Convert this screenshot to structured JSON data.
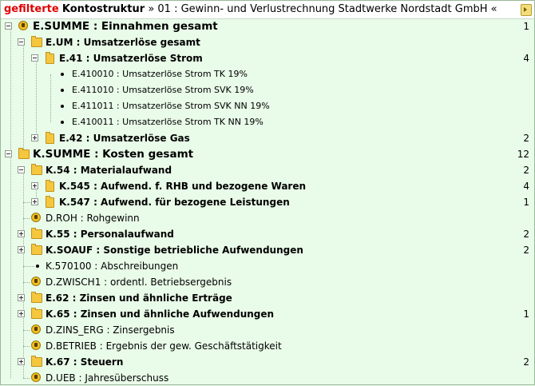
{
  "header": {
    "filter_label": "gefilterte",
    "title": "Kontostruktur",
    "path": "» 01 : Gewinn- und Verlustrechnung Stadtwerke Nordstadt GmbH «"
  },
  "rows": [
    {
      "label": "E.SUMME : Einnahmen gesamt",
      "count": "1"
    },
    {
      "label": "E.UM : Umsatzerlöse  gesamt",
      "count": ""
    },
    {
      "label": "E.41 : Umsatzerlöse Strom",
      "count": "4"
    },
    {
      "label": "E.410010 : Umsatzerlöse Strom TK 19%",
      "count": ""
    },
    {
      "label": "E.411010 : Umsatzerlöse Strom SVK 19%",
      "count": ""
    },
    {
      "label": "E.411011 : Umsatzerlöse Strom SVK NN 19%",
      "count": ""
    },
    {
      "label": "E.410011 : Umsatzerlöse Strom TK NN 19%",
      "count": ""
    },
    {
      "label": "E.42 : Umsatzerlöse Gas",
      "count": "2"
    },
    {
      "label": "K.SUMME : Kosten gesamt",
      "count": "12"
    },
    {
      "label": "K.54 : Materialaufwand",
      "count": "2"
    },
    {
      "label": "K.545 : Aufwend. f. RHB und bezogene Waren",
      "count": "4"
    },
    {
      "label": "K.547 : Aufwend. für bezogene Leistungen",
      "count": "1"
    },
    {
      "label": "D.ROH : Rohgewinn",
      "count": ""
    },
    {
      "label": "K.55 : Personalaufwand",
      "count": "2"
    },
    {
      "label": "K.SOAUF : Sonstige  betriebliche  Aufwendungen",
      "count": "2"
    },
    {
      "label": "K.570100 : Abschreibungen",
      "count": ""
    },
    {
      "label": "D.ZWISCH1 : ordentl. Betriebsergebnis",
      "count": ""
    },
    {
      "label": "E.62 : Zinsen und ähnliche Erträge",
      "count": ""
    },
    {
      "label": "K.65 : Zinsen und ähnliche Aufwendungen",
      "count": "1"
    },
    {
      "label": "D.ZINS_ERG : Zinsergebnis",
      "count": ""
    },
    {
      "label": "D.BETRIEB : Ergebnis der gew. Geschäftstätigkeit",
      "count": ""
    },
    {
      "label": "K.67 : Steuern",
      "count": "2"
    },
    {
      "label": "D.UEB : Jahresüberschuss",
      "count": ""
    }
  ]
}
